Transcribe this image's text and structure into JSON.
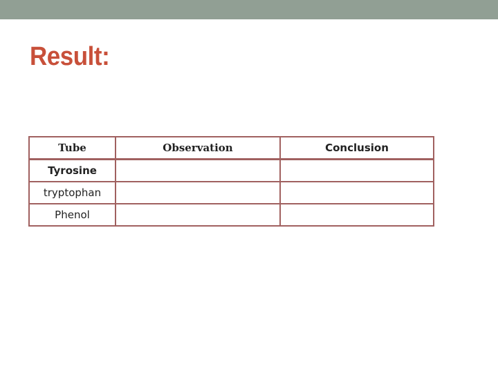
{
  "slide": {
    "title": "Result:",
    "colors": {
      "top_bar": "#919f94",
      "title": "#c8503a",
      "table_border": "#a0605f"
    }
  },
  "table": {
    "headers": [
      "Tube",
      "Observation",
      "Conclusion"
    ],
    "rows": [
      {
        "tube": "Tyrosine",
        "observation": "",
        "conclusion": ""
      },
      {
        "tube": "tryptophan",
        "observation": "",
        "conclusion": ""
      },
      {
        "tube": "Phenol",
        "observation": "",
        "conclusion": ""
      }
    ]
  }
}
